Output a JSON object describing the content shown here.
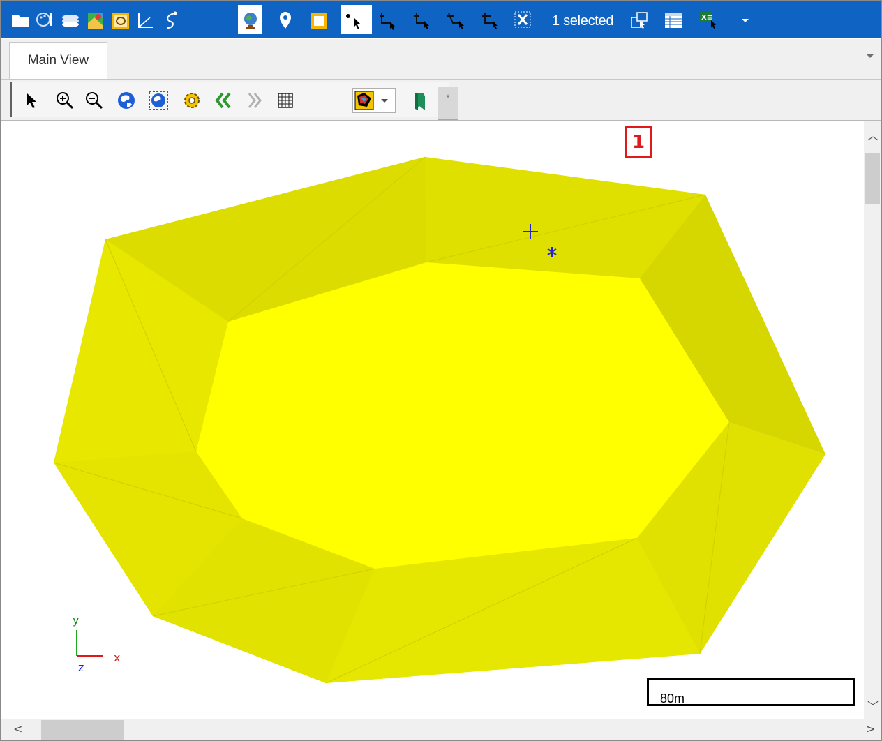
{
  "toolbar": {
    "selection_status": "1 selected",
    "buttons": [
      {
        "name": "open-folder-icon"
      },
      {
        "name": "symbology-icon"
      },
      {
        "name": "layers-icon"
      },
      {
        "name": "map-icon"
      },
      {
        "name": "contour-icon"
      },
      {
        "name": "measure-icon"
      },
      {
        "name": "survey-icon"
      },
      {
        "name": "globe-icon"
      },
      {
        "name": "pin-icon"
      },
      {
        "name": "frame-icon"
      },
      {
        "name": "select-point-icon"
      },
      {
        "name": "select-vertex-icon"
      },
      {
        "name": "select-edge-icon"
      },
      {
        "name": "select-face-icon"
      },
      {
        "name": "select-element-icon"
      },
      {
        "name": "clear-selection-icon"
      },
      {
        "name": "zoom-to-selection-icon"
      },
      {
        "name": "attribute-table-icon"
      },
      {
        "name": "export-excel-icon"
      },
      {
        "name": "more-dropdown-icon"
      }
    ]
  },
  "tabs": [
    {
      "label": "Main View",
      "active": true
    }
  ],
  "view_toolbar": {
    "tools": [
      "pointer-icon",
      "zoom-in-icon",
      "zoom-out-icon",
      "zoom-extents-icon",
      "zoom-previous-icon",
      "settings-icon",
      "previous-view-icon",
      "next-view-icon",
      "grid-icon",
      "render-mode-icon",
      "bookmark-icon"
    ],
    "grip_label": "*"
  },
  "viewport": {
    "badge_label": "1",
    "axes": {
      "y": "y",
      "x": "x",
      "z": "z"
    },
    "scale_label": "80m",
    "colors": {
      "outer": "#e6e600",
      "inner": "#ffff00",
      "shade": "#d4d400"
    }
  }
}
